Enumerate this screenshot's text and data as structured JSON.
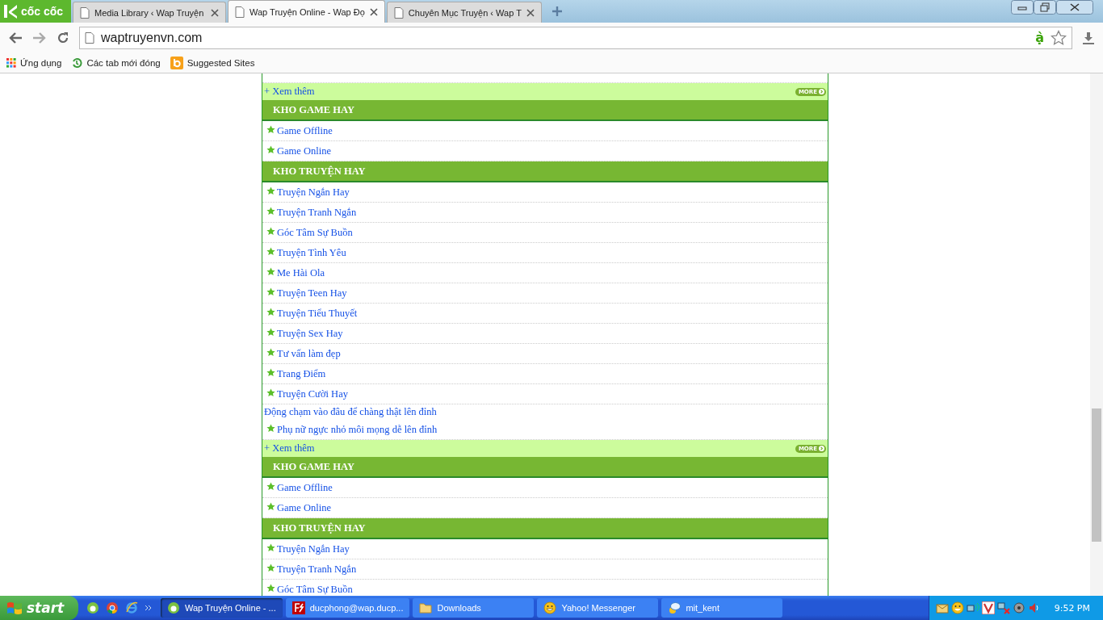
{
  "browser": {
    "logo": "cốc cốc",
    "tabs": [
      {
        "title": "Media Library ‹ Wap Truyện",
        "selected": false
      },
      {
        "title": "Wap Truyện Online - Wap Đọ",
        "selected": true
      },
      {
        "title": "Chuyên Mục Truyện ‹ Wap T",
        "selected": false
      }
    ],
    "address": "waptruyenvn.com",
    "address_badge": "ạ̀",
    "bookmarks": [
      {
        "label": "Ứng dụng",
        "kind": "apps"
      },
      {
        "label": "Các tab mới đóng",
        "kind": "history"
      },
      {
        "label": "Suggested Sites",
        "kind": "bing"
      }
    ]
  },
  "page": {
    "blocks": [
      {
        "kind": "cut"
      },
      {
        "kind": "more",
        "label": "+ Xem thêm",
        "badge": "MORE"
      },
      {
        "kind": "header",
        "label": "KHO GAME HAY"
      },
      {
        "kind": "item",
        "label": "Game Offline"
      },
      {
        "kind": "item",
        "label": "Game Online"
      },
      {
        "kind": "header",
        "label": "KHO TRUYỆN HAY"
      },
      {
        "kind": "item",
        "label": "Truyện Ngắn Hay"
      },
      {
        "kind": "item",
        "label": "Truyện Tranh Ngắn"
      },
      {
        "kind": "item",
        "label": "Góc Tâm Sự Buồn"
      },
      {
        "kind": "item",
        "label": "Truyện Tình Yêu"
      },
      {
        "kind": "item",
        "label": "Me Hài Ola"
      },
      {
        "kind": "item",
        "label": "Truyện Teen Hay"
      },
      {
        "kind": "item",
        "label": "Truyện Tiểu Thuyết"
      },
      {
        "kind": "item",
        "label": "Truyện Sex Hay"
      },
      {
        "kind": "item",
        "label": "Tư vấn làm đẹp"
      },
      {
        "kind": "item",
        "label": "Trang Điểm"
      },
      {
        "kind": "item",
        "label": "Truyện Cười Hay"
      },
      {
        "kind": "plain",
        "label": "Động chạm vào đâu để chàng thật lên đỉnh"
      },
      {
        "kind": "item",
        "label": "Phụ nữ ngực nhỏ môi mọng dễ lên đỉnh"
      },
      {
        "kind": "more",
        "label": "+ Xem thêm",
        "badge": "MORE"
      },
      {
        "kind": "header",
        "label": "KHO GAME HAY"
      },
      {
        "kind": "item",
        "label": "Game Offline"
      },
      {
        "kind": "item",
        "label": "Game Online"
      },
      {
        "kind": "header",
        "label": "KHO TRUYỆN HAY"
      },
      {
        "kind": "item",
        "label": "Truyện Ngắn Hay"
      },
      {
        "kind": "item",
        "label": "Truyện Tranh Ngắn"
      },
      {
        "kind": "item",
        "label": "Góc Tâm Sự Buồn"
      }
    ]
  },
  "taskbar": {
    "start": "start",
    "tasks": [
      {
        "label": "Wap Truyện Online - ...",
        "kind": "browser",
        "selected": true
      },
      {
        "label": "ducphong@wap.ducp...",
        "kind": "ftp",
        "selected": false
      },
      {
        "label": "Downloads",
        "kind": "folder",
        "selected": false
      },
      {
        "label": "Yahoo! Messenger",
        "kind": "yahoo",
        "selected": false
      },
      {
        "label": "mit_kent",
        "kind": "chat",
        "selected": false
      }
    ],
    "clock": "9:52 PM"
  }
}
